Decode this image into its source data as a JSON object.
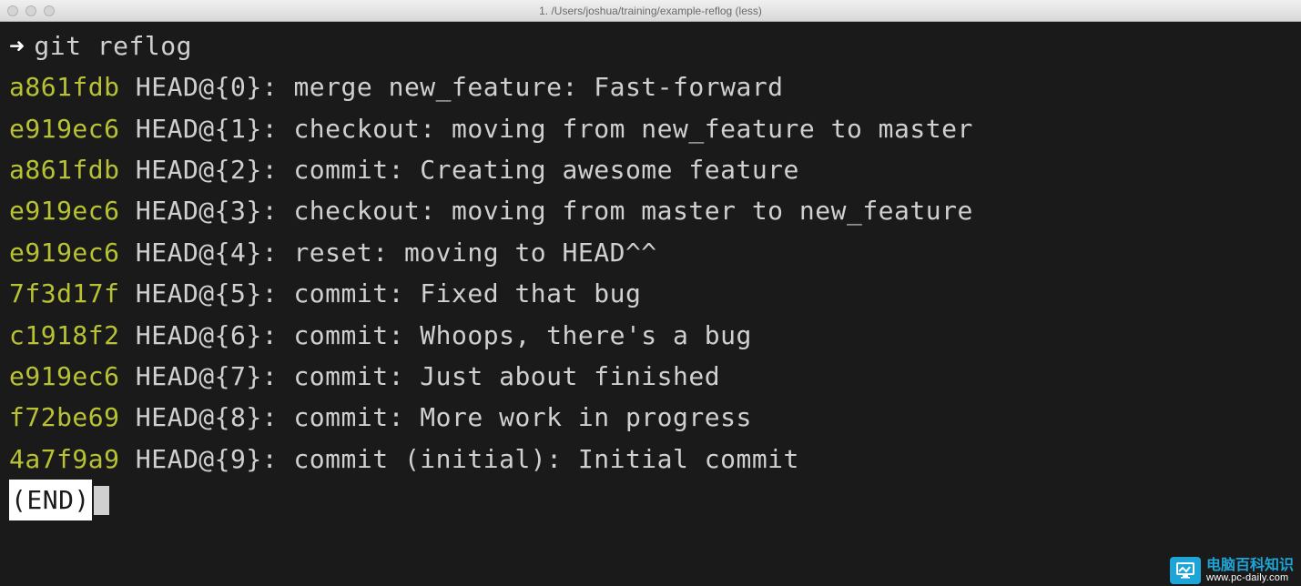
{
  "window": {
    "title": "1. /Users/joshua/training/example-reflog (less)"
  },
  "prompt": {
    "arrow": "➜",
    "command": "git reflog"
  },
  "reflog": [
    {
      "hash": "a861fdb",
      "ref": "HEAD@{0}:",
      "msg": "merge new_feature: Fast-forward"
    },
    {
      "hash": "e919ec6",
      "ref": "HEAD@{1}:",
      "msg": "checkout: moving from new_feature to master"
    },
    {
      "hash": "a861fdb",
      "ref": "HEAD@{2}:",
      "msg": "commit: Creating awesome feature"
    },
    {
      "hash": "e919ec6",
      "ref": "HEAD@{3}:",
      "msg": "checkout: moving from master to new_feature"
    },
    {
      "hash": "e919ec6",
      "ref": "HEAD@{4}:",
      "msg": "reset: moving to HEAD^^"
    },
    {
      "hash": "7f3d17f",
      "ref": "HEAD@{5}:",
      "msg": "commit: Fixed that bug"
    },
    {
      "hash": "c1918f2",
      "ref": "HEAD@{6}:",
      "msg": "commit: Whoops, there's a bug"
    },
    {
      "hash": "e919ec6",
      "ref": "HEAD@{7}:",
      "msg": "commit: Just about finished"
    },
    {
      "hash": "f72be69",
      "ref": "HEAD@{8}:",
      "msg": "commit: More work in progress"
    },
    {
      "hash": "4a7f9a9",
      "ref": "HEAD@{9}:",
      "msg": "commit (initial): Initial commit"
    }
  ],
  "pager": {
    "end": "(END)"
  },
  "watermark": {
    "title": "电脑百科知识",
    "url": "www.pc-daily.com"
  }
}
